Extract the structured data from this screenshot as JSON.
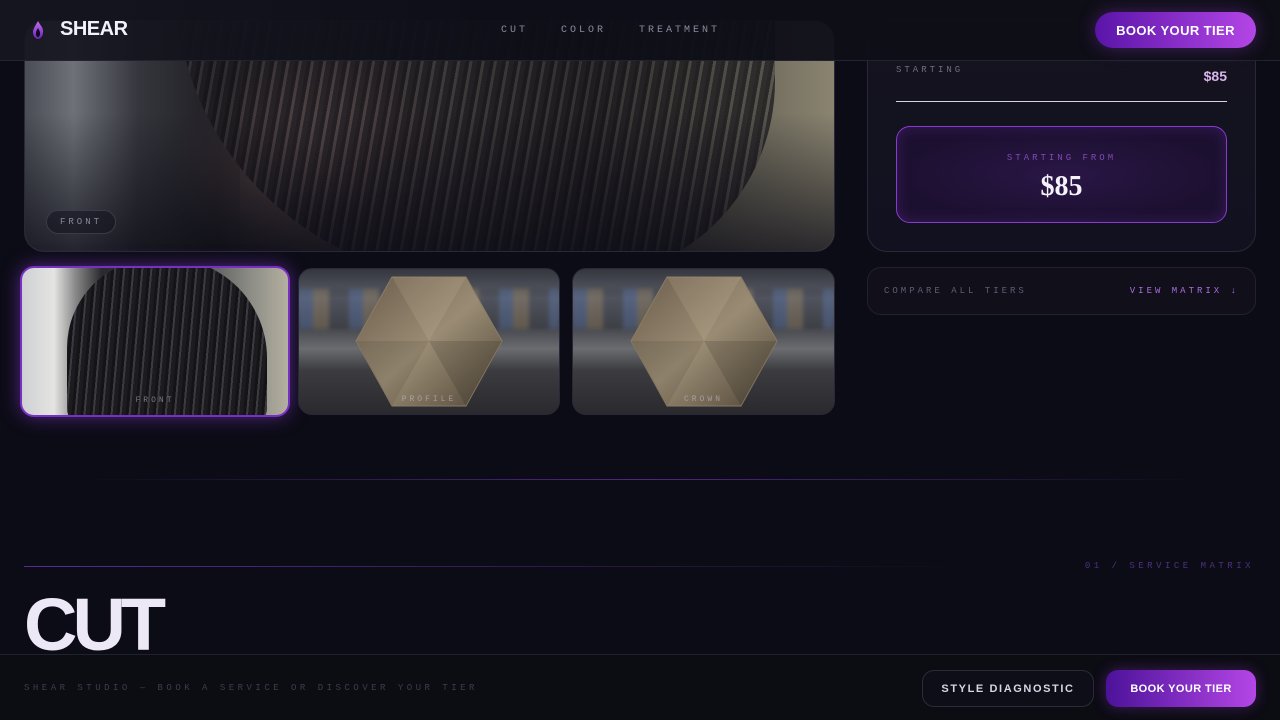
{
  "header": {
    "brand": "SHEAR",
    "brand_icon": "flame-icon",
    "nav": [
      {
        "label": "CUT"
      },
      {
        "label": "COLOR"
      },
      {
        "label": "TREATMENT"
      }
    ],
    "cta": "BOOK YOUR TIER"
  },
  "gallery": {
    "hero_tag": "FRONT",
    "thumbnails": [
      {
        "label": "FRONT",
        "active": true
      },
      {
        "label": "PROFILE",
        "active": false
      },
      {
        "label": "CROWN",
        "active": false
      }
    ]
  },
  "pricing": {
    "row_label": "STARTING",
    "row_value": "$85",
    "box_label": "STARTING FROM",
    "box_value": "$85"
  },
  "compare": {
    "label": "COMPARE ALL TIERS",
    "link": "VIEW MATRIX ↓"
  },
  "section": {
    "index": "01 / SERVICE MATRIX",
    "title": "CUT"
  },
  "footer": {
    "text": "SHEAR STUDIO — BOOK A SERVICE OR DISCOVER YOUR TIER",
    "diagnostic_button": "STYLE DIAGNOSTIC",
    "book_button": "BOOK YOUR TIER"
  },
  "colors": {
    "background": "#0c0c16",
    "accent": "#b446e6",
    "accent_dark": "#5a14a8",
    "price_text": "#d7b4ec"
  }
}
